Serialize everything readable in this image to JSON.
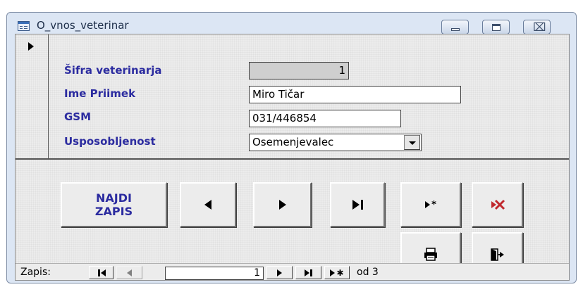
{
  "window": {
    "title": "O_vnos_veterinar",
    "icon": "form-icon",
    "controls": [
      "minimize-icon",
      "maximize-icon",
      "close-icon"
    ],
    "close_glyph": "⌧"
  },
  "form": {
    "fields": {
      "sifra": {
        "label": "Šifra veterinarja",
        "value": "1"
      },
      "ime_priimek": {
        "label": "Ime Priimek",
        "value": "Miro Tičar"
      },
      "gsm": {
        "label": "GSM",
        "value": "031/446854"
      },
      "usposobljenost": {
        "label": "Usposobljenost",
        "value": "Osemenjevalec"
      }
    },
    "colors": {
      "label": "#2c2ca0",
      "background": "#ececec",
      "locked_field": "#cfcfcf",
      "delete_icon": "#c0282d"
    }
  },
  "buttons": {
    "najdi_zapis": "NAJDI\nZAPIS",
    "icons": [
      "previous-record-icon",
      "next-record-icon",
      "last-record-icon",
      "new-record-icon",
      "delete-record-icon",
      "print-icon",
      "exit-icon"
    ]
  },
  "navigation": {
    "label": "Zapis:",
    "current": "1",
    "of_text": "od 3"
  }
}
